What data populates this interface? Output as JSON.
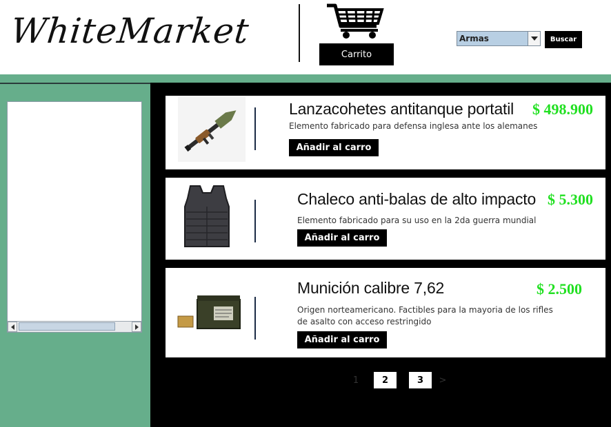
{
  "header": {
    "logo": "WhiteMarket",
    "cart_label": "Carrito",
    "category_selected": "Armas",
    "search_label": "Buscar"
  },
  "products": [
    {
      "title": "Lanzacohetes antitanque portatil",
      "price": "$ 498.900",
      "description": "Elemento fabricado para defensa inglesa ante los alemanes",
      "add_label": "Añadir al carro",
      "image_icon": "rocket-launcher-icon"
    },
    {
      "title": "Chaleco anti-balas de alto impacto",
      "price": "$ 5.300",
      "description": "Elemento fabricado para su uso en la 2da guerra mundial",
      "add_label": "Añadir al carro",
      "image_icon": "bulletproof-vest-icon"
    },
    {
      "title": "Munición calibre 7,62",
      "price": "$ 2.500",
      "description_line1": "Origen norteamericano. Factibles para la mayoria de los rifles",
      "description_line2": "de asalto con acceso restringido",
      "add_label": "Añadir al carro",
      "image_icon": "ammo-box-icon"
    }
  ],
  "pagination": {
    "first": "1",
    "second": "2",
    "third": "3",
    "next": ">"
  },
  "colors": {
    "accent_green": "#66ae8b",
    "price_green": "#22e022"
  }
}
